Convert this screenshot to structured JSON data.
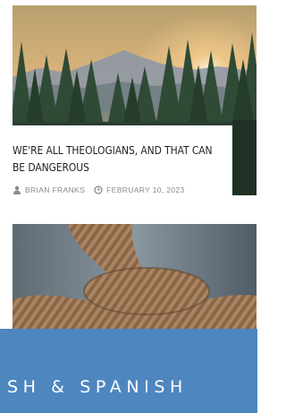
{
  "post1": {
    "title": "WE'RE ALL THEOLOGIANS, AND THAT CAN BE DANGEROUS",
    "author": "BRIAN FRANKS",
    "date": "FEBRUARY 10, 2023",
    "image": "mountain-forest-sunset",
    "author_icon": "user-icon",
    "date_icon": "clock-icon"
  },
  "post2": {
    "image": "knotted-rope"
  },
  "banner": {
    "text": "SH & SPANISH",
    "color": "#4e86bf"
  }
}
